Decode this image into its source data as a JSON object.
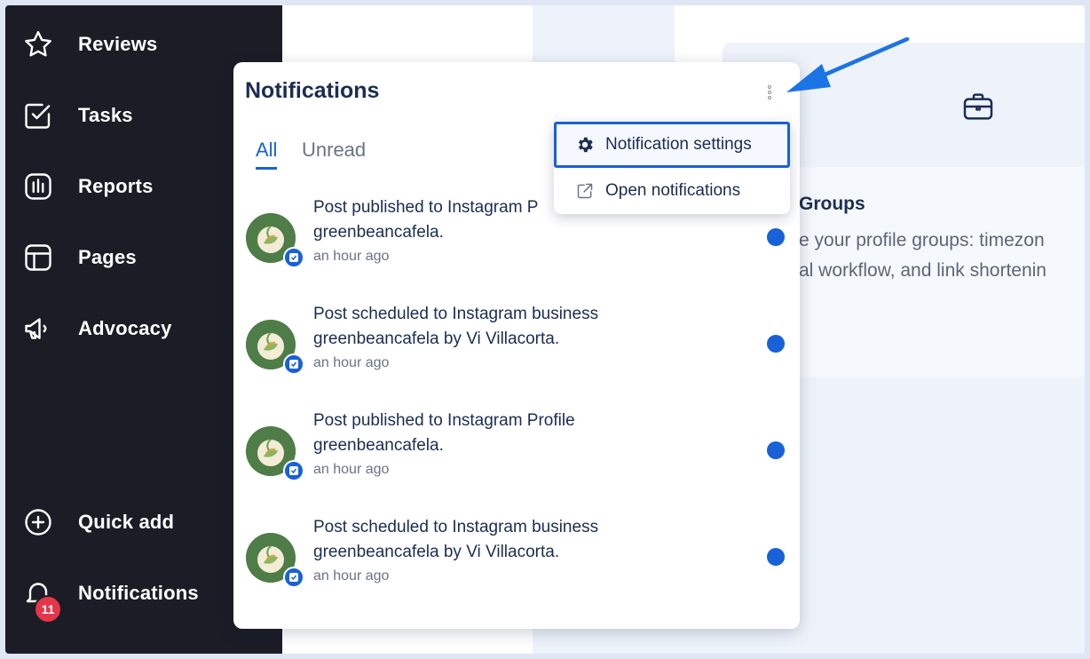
{
  "sidebar": {
    "items": [
      {
        "label": "Reviews",
        "icon": "star-icon"
      },
      {
        "label": "Tasks",
        "icon": "checkbox-icon"
      },
      {
        "label": "Reports",
        "icon": "bar-chart-icon"
      },
      {
        "label": "Pages",
        "icon": "layout-icon"
      },
      {
        "label": "Advocacy",
        "icon": "megaphone-icon"
      }
    ],
    "quick_add": {
      "label": "Quick add",
      "icon": "plus-circle-icon"
    },
    "notifications": {
      "label": "Notifications",
      "icon": "bell-icon",
      "badge": "11"
    }
  },
  "background_card": {
    "heading": "Groups",
    "description_line1": "e your profile groups: timezon",
    "description_line2": "al workflow, and link shortenin"
  },
  "panel": {
    "title": "Notifications",
    "tabs": [
      {
        "label": "All",
        "active": true
      },
      {
        "label": "Unread",
        "active": false
      }
    ],
    "notifications": [
      {
        "line1": "Post published to Instagram P",
        "line2": "greenbeancafela.",
        "time": "an hour ago",
        "unread": true
      },
      {
        "line1": "Post scheduled to Instagram business",
        "line2": "greenbeancafela by Vi Villacorta.",
        "time": "an hour ago",
        "unread": true
      },
      {
        "line1": "Post published to Instagram Profile",
        "line2": "greenbeancafela.",
        "time": "an hour ago",
        "unread": true
      },
      {
        "line1": "Post scheduled to Instagram business",
        "line2": "greenbeancafela by Vi Villacorta.",
        "time": "an hour ago",
        "unread": true
      }
    ]
  },
  "menu": {
    "settings_label": "Notification settings",
    "open_label": "Open notifications"
  },
  "colors": {
    "sidebar_bg": "#1b1c26",
    "accent": "#1861d8",
    "badge": "#e5354b",
    "title_text": "#1c2d52"
  }
}
